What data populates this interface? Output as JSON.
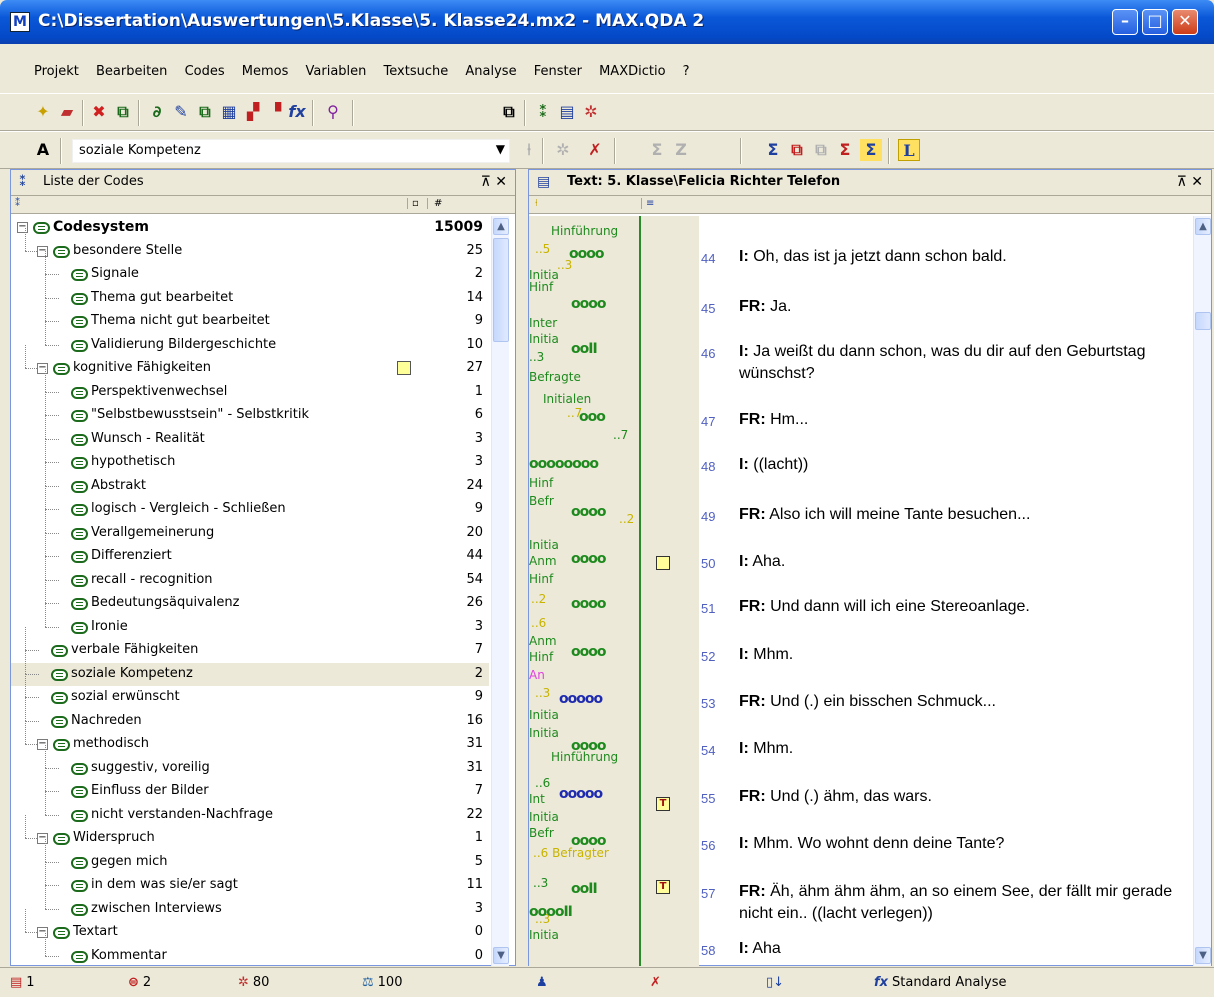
{
  "window": {
    "title": "C:\\Dissertation\\Auswertungen\\5.Klasse\\5. Klasse24.mx2 - MAX.QDA 2",
    "app_icon_letter": "M"
  },
  "menu": [
    "Projekt",
    "Bearbeiten",
    "Codes",
    "Memos",
    "Variablen",
    "Textsuche",
    "Analyse",
    "Fenster",
    "MAXDictio",
    "?"
  ],
  "toolbar": {
    "code_combo_value": "soziale Kompetenz"
  },
  "codes_panel": {
    "title": "Liste der Codes",
    "count_header": "#",
    "rows": [
      {
        "label": "Codesystem",
        "count": "15009"
      },
      {
        "label": "besondere Stelle",
        "count": "25"
      },
      {
        "label": "Signale",
        "count": "2"
      },
      {
        "label": "Thema gut bearbeitet",
        "count": "14"
      },
      {
        "label": "Thema nicht gut bearbeitet",
        "count": "9"
      },
      {
        "label": "Validierung Bildergeschichte",
        "count": "10"
      },
      {
        "label": "kognitive Fähigkeiten",
        "count": "27"
      },
      {
        "label": "Perspektivenwechsel",
        "count": "1"
      },
      {
        "label": "\"Selbstbewusstsein\" - Selbstkritik",
        "count": "6"
      },
      {
        "label": "Wunsch - Realität",
        "count": "3"
      },
      {
        "label": "hypothetisch",
        "count": "3"
      },
      {
        "label": "Abstrakt",
        "count": "24"
      },
      {
        "label": "logisch - Vergleich - Schließen",
        "count": "9"
      },
      {
        "label": "Verallgemeinerung",
        "count": "20"
      },
      {
        "label": "Differenziert",
        "count": "44"
      },
      {
        "label": "recall - recognition",
        "count": "54"
      },
      {
        "label": "Bedeutungsäquivalenz",
        "count": "26"
      },
      {
        "label": "Ironie",
        "count": "3"
      },
      {
        "label": "verbale Fähigkeiten",
        "count": "7"
      },
      {
        "label": "soziale Kompetenz",
        "count": "2"
      },
      {
        "label": "sozial erwünscht",
        "count": "9"
      },
      {
        "label": "Nachreden",
        "count": "16"
      },
      {
        "label": "methodisch",
        "count": "31"
      },
      {
        "label": "suggestiv, voreilig",
        "count": "31"
      },
      {
        "label": "Einfluss der Bilder",
        "count": "7"
      },
      {
        "label": "nicht verstanden-Nachfrage",
        "count": "22"
      },
      {
        "label": "Widerspruch",
        "count": "1"
      },
      {
        "label": "gegen mich",
        "count": "5"
      },
      {
        "label": "in dem was sie/er sagt",
        "count": "11"
      },
      {
        "label": "zwischen Interviews",
        "count": "3"
      },
      {
        "label": "Textart",
        "count": "0"
      },
      {
        "label": "Kommentar",
        "count": "0"
      }
    ]
  },
  "text_panel": {
    "title": "Text: 5. Klasse\\Felicia Richter Telefon",
    "paragraphs": [
      {
        "num": "44",
        "speaker": "I:",
        "text": "Oh, das ist ja jetzt dann schon bald."
      },
      {
        "num": "45",
        "speaker": "FR:",
        "text": "Ja."
      },
      {
        "num": "46",
        "speaker": "I:",
        "text": "Ja weißt du dann schon, was du dir auf den Geburtstag wünschst?"
      },
      {
        "num": "47",
        "speaker": "FR:",
        "text": "Hm..."
      },
      {
        "num": "48",
        "speaker": "I:",
        "text": "((lacht))"
      },
      {
        "num": "49",
        "speaker": "FR:",
        "text": "Also ich will meine Tante besuchen..."
      },
      {
        "num": "50",
        "speaker": "I:",
        "text": "Aha."
      },
      {
        "num": "51",
        "speaker": "FR:",
        "text": "Und dann will ich eine Stereoanlage."
      },
      {
        "num": "52",
        "speaker": "I:",
        "text": "Mhm."
      },
      {
        "num": "53",
        "speaker": "FR:",
        "text": "Und (.) ein bisschen Schmuck..."
      },
      {
        "num": "54",
        "speaker": "I:",
        "text": "Mhm."
      },
      {
        "num": "55",
        "speaker": "FR:",
        "text": "Und (.) ähm, das wars."
      },
      {
        "num": "56",
        "speaker": "I:",
        "text": "Mhm. Wo wohnt denn deine Tante?"
      },
      {
        "num": "57",
        "speaker": "FR:",
        "text": "Äh, ähm ähm ähm, an so einem See, der fällt mir gerade nicht ein.. ((lacht verlegen))"
      },
      {
        "num": "58",
        "speaker": "I:",
        "text": "Aha"
      }
    ],
    "stripe_labels": [
      "Hinführung",
      "..5",
      "..3",
      "Initia",
      "Hinf",
      "Inter",
      "Initia",
      "..3",
      "Befragte",
      "Initialen",
      "..7",
      "..7",
      "Hinf",
      "Befr",
      "..2",
      "Initia",
      "Anm",
      "Hinf",
      "..2",
      "..6",
      "Anm",
      "Hinf",
      "An",
      "..3",
      "Initia",
      "Initia",
      "Hinführung",
      "..6",
      "Int",
      "Initia",
      "Befr",
      "..6 Befragter",
      "..3",
      "..3",
      "Initia"
    ]
  },
  "status": {
    "docs": "1",
    "codes": "2",
    "coded_segments": "80",
    "activated": "100",
    "analysis": "Standard Analyse"
  }
}
